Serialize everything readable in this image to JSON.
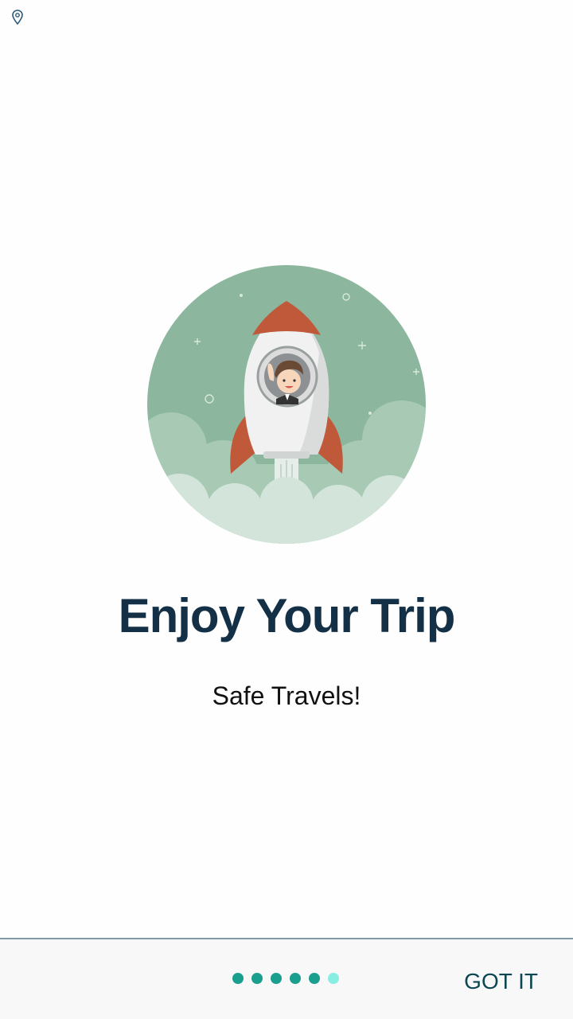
{
  "status_bar": {
    "icons": [
      "location-icon"
    ]
  },
  "onboarding": {
    "illustration": "rocket-launch-illustration",
    "title": "Enjoy Your Trip",
    "subtitle": "Safe Travels!"
  },
  "pager": {
    "total_pages": 6,
    "current_page": 6
  },
  "bottom_bar": {
    "got_it_label": "GOT IT"
  },
  "colors": {
    "title": "#133046",
    "dot": "#1a9e8e",
    "dot_active": "#88ede3",
    "hero_background": "#8cb79e",
    "rocket_fins": "#c0583a"
  }
}
